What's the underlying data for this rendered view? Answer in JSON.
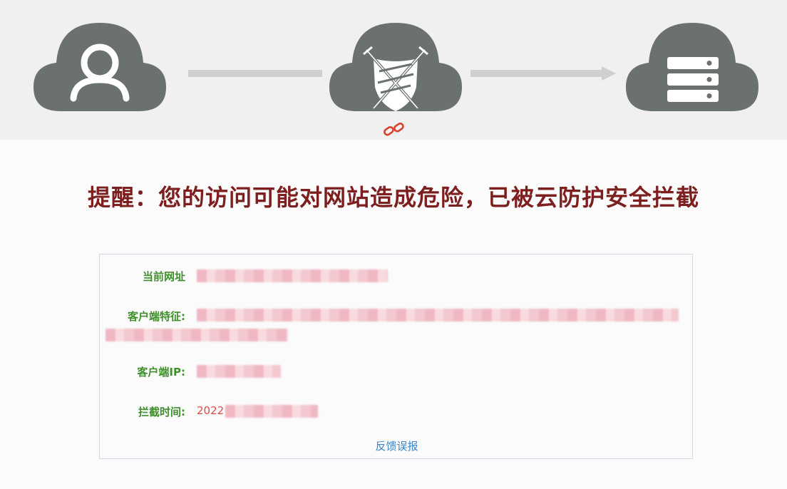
{
  "colors": {
    "cloud": "#6b7071",
    "connector": "#cfcfcf",
    "title": "#7d1f1f",
    "label": "#3f8f2c",
    "value": "#e04848",
    "link": "#3a86c8",
    "broken_link": "#d9412b"
  },
  "icons": {
    "user": "user-icon",
    "shield": "shield-swords-icon",
    "server": "server-icon",
    "broken_link": "broken-link-icon"
  },
  "warning": {
    "title": "提醒：您的访问可能对网站造成危险，已被云防护安全拦截"
  },
  "info": {
    "rows": [
      {
        "label": "当前网址",
        "value": ""
      },
      {
        "label": "客户端特征:",
        "value": ""
      },
      {
        "label": "客户端IP:",
        "value": ""
      },
      {
        "label": "拦截时间:",
        "value": "2022"
      }
    ],
    "feedback_label": "反馈误报"
  }
}
